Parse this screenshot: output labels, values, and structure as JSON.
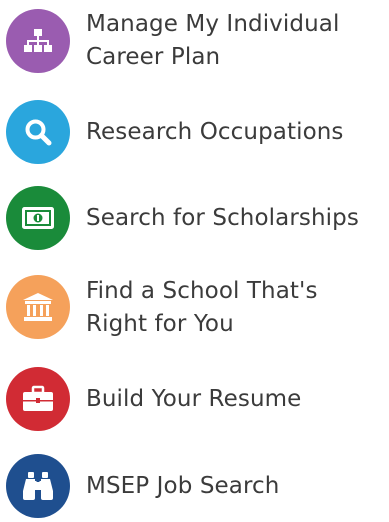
{
  "menu": {
    "items": [
      {
        "label": "Manage My Individual Career Plan",
        "icon": "org-chart-icon",
        "color": "#9a5cb0"
      },
      {
        "label": "Research Occupations",
        "icon": "search-icon",
        "color": "#2aa6dd"
      },
      {
        "label": "Search for Scholarships",
        "icon": "money-icon",
        "color": "#1a8b3a"
      },
      {
        "label": "Find a School That's Right for You",
        "icon": "school-building-icon",
        "color": "#f5a15b"
      },
      {
        "label": "Build Your Resume",
        "icon": "briefcase-icon",
        "color": "#d12b34"
      },
      {
        "label": "MSEP Job Search",
        "icon": "binoculars-icon",
        "color": "#1f4f8f"
      }
    ]
  }
}
